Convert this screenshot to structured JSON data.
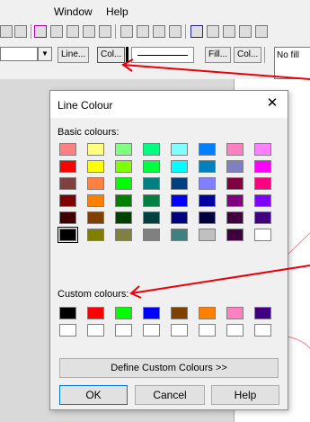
{
  "menubar": {
    "items": [
      "Window",
      "Help"
    ]
  },
  "toolbar2": {
    "line_button": "Line...",
    "colour_button": "Col...",
    "fill_button": "Fill...",
    "fill_colour_button": "Col...",
    "fill_value": "No fill"
  },
  "dialog": {
    "title": "Line Colour",
    "basic_label": "Basic colours:",
    "custom_label": "Custom colours:",
    "define_button": "Define Custom Colours >>",
    "ok_button": "OK",
    "cancel_button": "Cancel",
    "help_button": "Help",
    "basic_colours": [
      [
        "#ff8080",
        "#ffff80",
        "#80ff80",
        "#00ff80",
        "#80ffff",
        "#0080ff",
        "#ff80c0",
        "#ff80ff"
      ],
      [
        "#ff0000",
        "#ffff00",
        "#80ff00",
        "#00ff40",
        "#00ffff",
        "#0080c0",
        "#8080c0",
        "#ff00ff"
      ],
      [
        "#804040",
        "#ff8040",
        "#00ff00",
        "#008080",
        "#004080",
        "#8080ff",
        "#800040",
        "#ff0080"
      ],
      [
        "#800000",
        "#ff8000",
        "#008000",
        "#008040",
        "#0000ff",
        "#0000a0",
        "#800080",
        "#8000ff"
      ],
      [
        "#400000",
        "#804000",
        "#004000",
        "#004040",
        "#000080",
        "#000040",
        "#400040",
        "#400080"
      ],
      [
        "#000000",
        "#808000",
        "#808040",
        "#808080",
        "#408080",
        "#c0c0c0",
        "#400040",
        "#ffffff"
      ]
    ],
    "custom_colours": [
      [
        "#000000",
        "#ff0000",
        "#00ff00",
        "#0000ff",
        "#804000",
        "#ff8000",
        "#ff80c0",
        "#400080"
      ],
      [
        "#ffffff",
        "#ffffff",
        "#ffffff",
        "#ffffff",
        "#ffffff",
        "#ffffff",
        "#ffffff",
        "#ffffff"
      ]
    ],
    "selected_basic": [
      5,
      0
    ]
  },
  "annotation_color": "#e8000b"
}
